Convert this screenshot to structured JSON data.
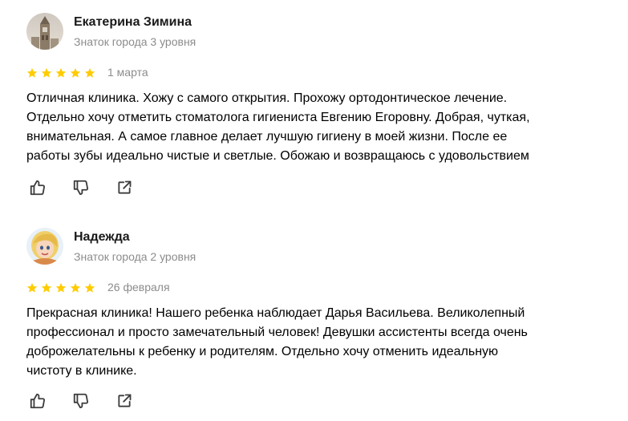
{
  "reviews": [
    {
      "author": "Екатерина Зимина",
      "level": "Знаток города 3 уровня",
      "rating": 5,
      "date": "1 марта",
      "text_lines": [
        "Отличная клиника. Хожу с самого открытия. Прохожу ортодонтическое лечение.",
        "Отдельно хочу отметить стоматолога гигиениста Евгению Егоровну. Добрая, чуткая,",
        "внимательная. А самое главное делает лучшую гигиену в моей жизни. После ее",
        "работы зубы идеально чистые и светлые. Обожаю и возвращаюсь с удовольствием"
      ],
      "avatar_icon": "tower-photo-avatar"
    },
    {
      "author": "Надежда",
      "level": "Знаток города 2 уровня",
      "rating": 5,
      "date": "26 февраля",
      "text_lines": [
        "Прекрасная клиника! Нашего ребенка наблюдает Дарья Васильева. Великолепный",
        "профессионал и просто замечательный человек! Девушки ассистенты всегда очень",
        "доброжелательны к ребенку и родителям. Отдельно хочу отменить идеальную",
        "чистоту в клинике."
      ],
      "avatar_icon": "cartoon-girl-avatar"
    }
  ],
  "actions": {
    "like_icon": "thumbs-up-icon",
    "dislike_icon": "thumbs-down-icon",
    "share_icon": "share-icon"
  },
  "colors": {
    "star": "#fc0",
    "secondary_text": "#8c8c8c",
    "icon": "#3d3d3d"
  }
}
